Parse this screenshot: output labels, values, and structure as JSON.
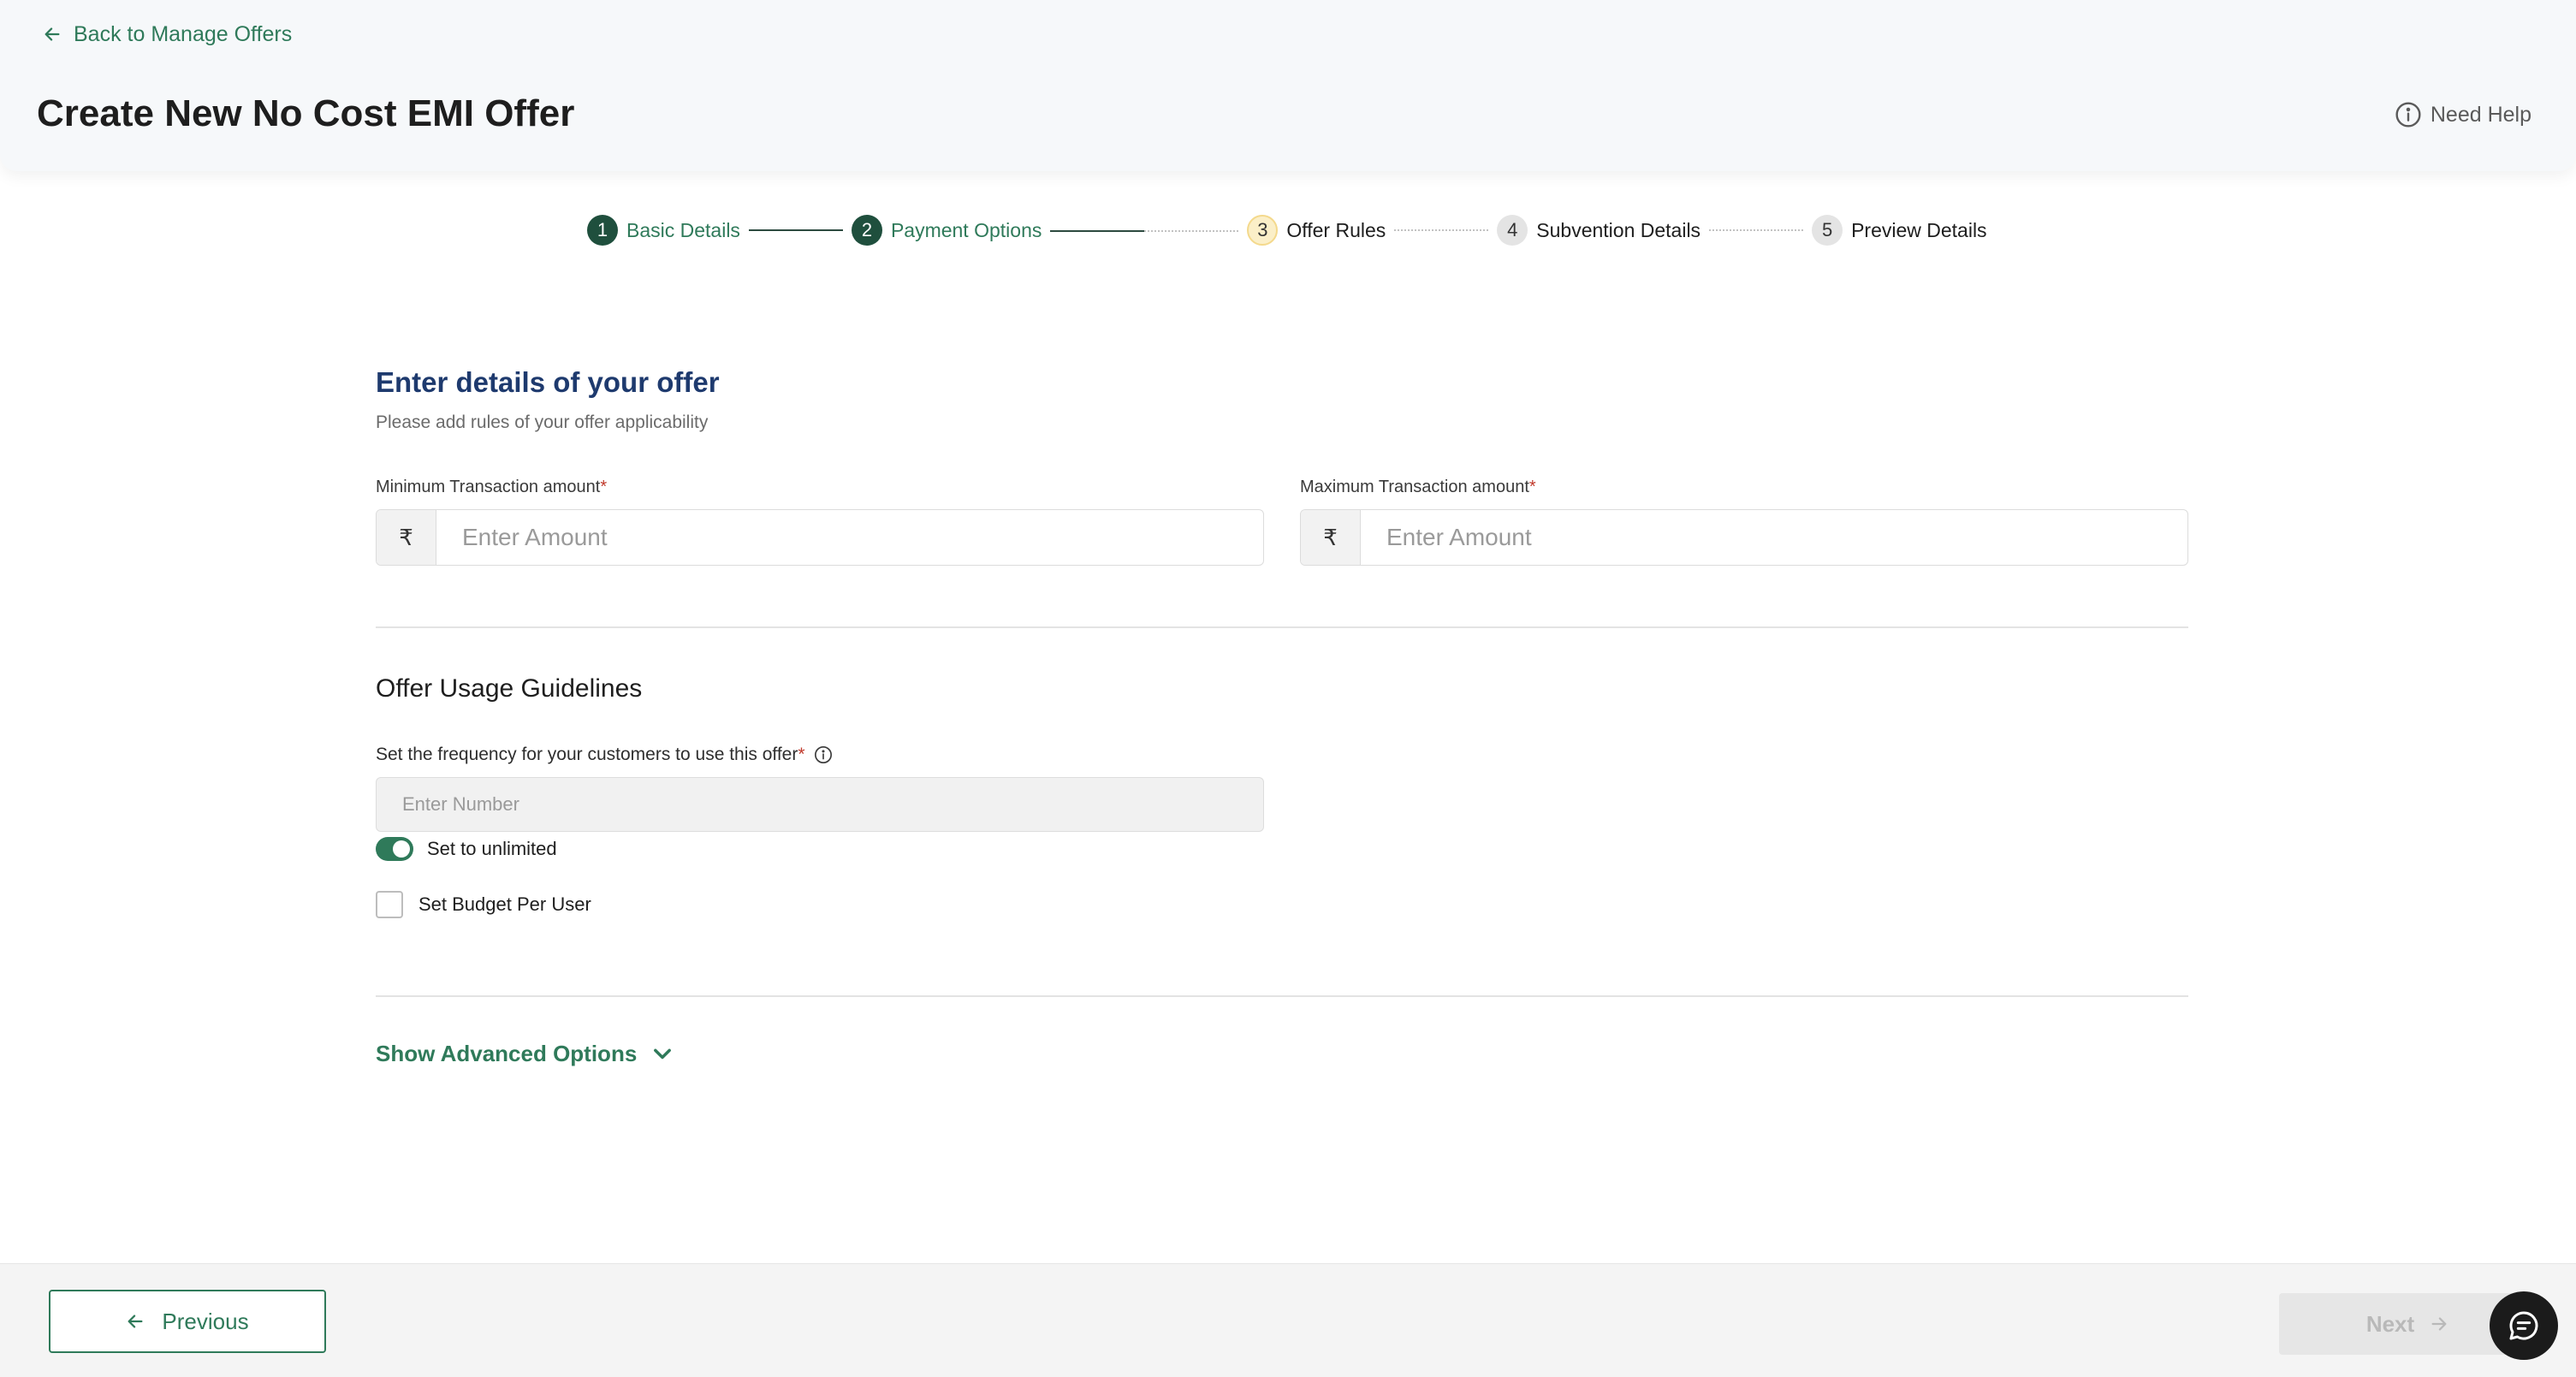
{
  "header": {
    "back_label": "Back to Manage Offers",
    "title": "Create New No Cost EMI Offer",
    "help_label": "Need Help"
  },
  "stepper": {
    "steps": [
      {
        "num": "1",
        "label": "Basic Details",
        "state": "done"
      },
      {
        "num": "2",
        "label": "Payment Options",
        "state": "done"
      },
      {
        "num": "3",
        "label": "Offer Rules",
        "state": "active"
      },
      {
        "num": "4",
        "label": "Subvention Details",
        "state": "pending"
      },
      {
        "num": "5",
        "label": "Preview Details",
        "state": "pending"
      }
    ]
  },
  "form": {
    "title": "Enter details of your offer",
    "subtitle": "Please add rules of your offer applicability",
    "min_amount": {
      "label": "Minimum Transaction amount",
      "required_mark": "*",
      "currency": "₹",
      "placeholder": "Enter Amount",
      "value": ""
    },
    "max_amount": {
      "label": "Maximum Transaction amount",
      "required_mark": "*",
      "currency": "₹",
      "placeholder": "Enter Amount",
      "value": ""
    },
    "usage": {
      "title": "Offer Usage Guidelines",
      "frequency_label": "Set the frequency for your customers to use this offer",
      "required_mark": "*",
      "frequency_placeholder": "Enter Number",
      "unlimited_label": "Set to unlimited",
      "unlimited_on": true,
      "budget_label": "Set Budget Per User",
      "budget_checked": false
    },
    "advanced_label": "Show Advanced Options"
  },
  "footer": {
    "previous_label": "Previous",
    "next_label": "Next"
  },
  "colors": {
    "accent": "#2f7a5a",
    "dark_step": "#1f4f3d",
    "title_blue": "#1e3a6e"
  }
}
